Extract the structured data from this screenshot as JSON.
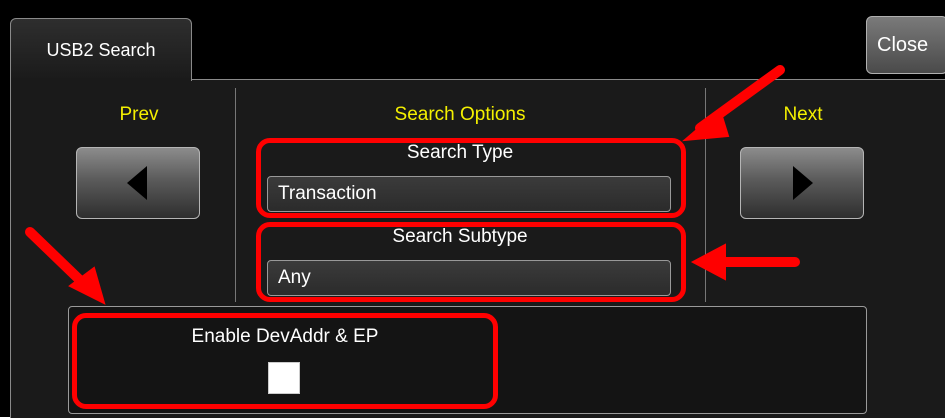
{
  "window": {
    "tab_label": "USB2 Search",
    "close_label": "Close"
  },
  "nav": {
    "prev_label": "Prev",
    "next_label": "Next"
  },
  "search_options": {
    "heading": "Search Options",
    "type_label": "Search Type",
    "type_value": "Transaction",
    "subtype_label": "Search Subtype",
    "subtype_value": "Any"
  },
  "filter": {
    "enable_label": "Enable DevAddr & EP",
    "enabled": false
  },
  "icons": {
    "prev": "triangle-left-icon",
    "next": "triangle-right-icon"
  },
  "colors": {
    "accent_yellow": "#f4f000",
    "highlight_red": "#ff0000"
  }
}
